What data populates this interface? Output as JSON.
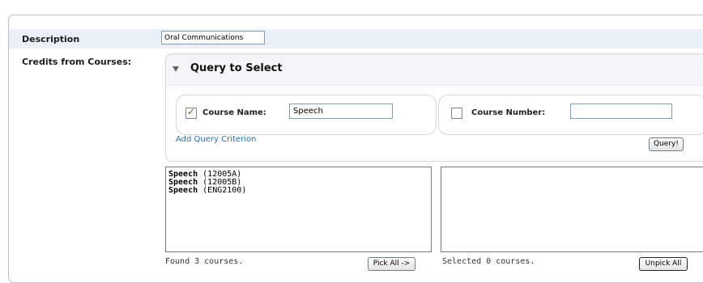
{
  "form": {
    "description_label": "Description",
    "description_value": "Oral Communications",
    "credits_label": "Credits from Courses:"
  },
  "query": {
    "title": "Query to Select",
    "toggle_icon": "triangle-down-icon",
    "criteria": [
      {
        "label": "Course Name:",
        "checked": true,
        "value": "Speech"
      },
      {
        "label": "Course Number:",
        "checked": false,
        "value": ""
      }
    ],
    "add_link": "Add Query Criterion",
    "query_button": "Query!"
  },
  "results": {
    "found": [
      {
        "name": "Speech",
        "code": "(12005A)"
      },
      {
        "name": "Speech",
        "code": "(12005B)"
      },
      {
        "name": "Speech",
        "code": "(ENG2100)"
      }
    ],
    "found_status": "Found 3 courses.",
    "pick_all_button": "Pick All ->",
    "selected_status": "Selected 0 courses.",
    "unpick_all_button": "Unpick All"
  }
}
